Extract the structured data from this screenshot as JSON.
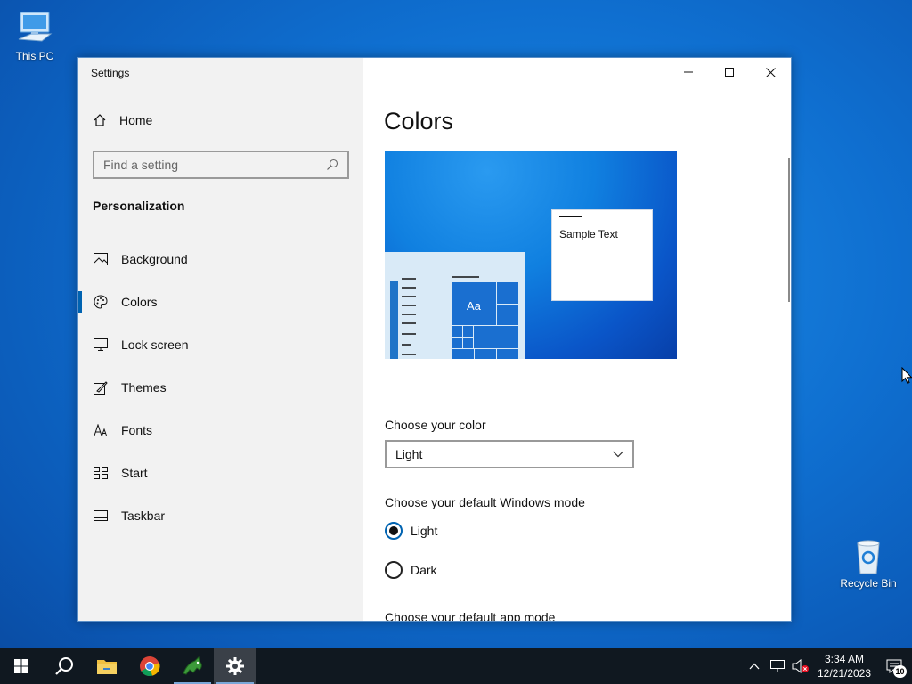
{
  "desktop": {
    "icons": [
      {
        "label": "This PC"
      },
      {
        "label": "Recycle Bin"
      }
    ]
  },
  "window": {
    "title": "Settings",
    "sidebar": {
      "home_label": "Home",
      "search_placeholder": "Find a setting",
      "section": "Personalization",
      "items": [
        {
          "label": "Background",
          "icon": "picture-icon"
        },
        {
          "label": "Colors",
          "icon": "palette-icon",
          "active": true
        },
        {
          "label": "Lock screen",
          "icon": "monitor-icon"
        },
        {
          "label": "Themes",
          "icon": "brush-icon"
        },
        {
          "label": "Fonts",
          "icon": "font-icon"
        },
        {
          "label": "Start",
          "icon": "start-grid-icon"
        },
        {
          "label": "Taskbar",
          "icon": "taskbar-icon"
        }
      ]
    },
    "content": {
      "title": "Colors",
      "preview": {
        "sample_text": "Sample Text",
        "tile_text": "Aa"
      },
      "choose_color_label": "Choose your color",
      "choose_color_value": "Light",
      "windows_mode_label": "Choose your default Windows mode",
      "windows_mode_options": [
        {
          "label": "Light",
          "selected": true
        },
        {
          "label": "Dark",
          "selected": false
        }
      ],
      "app_mode_label": "Choose your default app mode"
    }
  },
  "taskbar": {
    "clock_time": "3:34 AM",
    "clock_date": "12/21/2023",
    "notification_count": "10"
  },
  "colors": {
    "accent": "#0063b1",
    "taskbar": "#101820",
    "sidebar": "#f2f2f2"
  }
}
